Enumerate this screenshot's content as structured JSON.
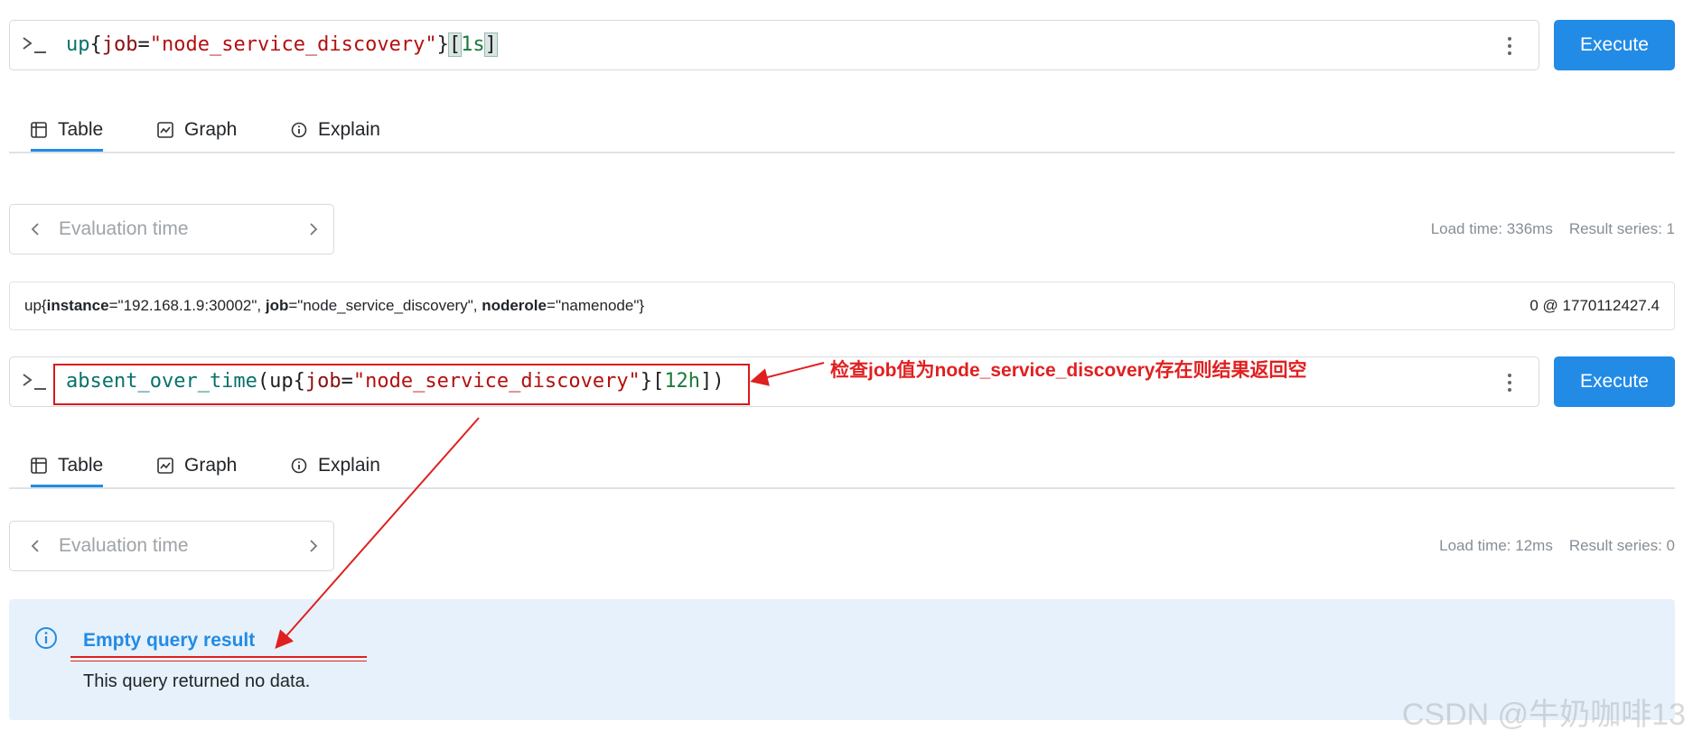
{
  "panels": [
    {
      "query": {
        "parts": [
          {
            "text": "up",
            "cls": "tk-fn"
          },
          {
            "text": "{",
            "cls": ""
          },
          {
            "text": "job",
            "cls": "tk-label"
          },
          {
            "text": "=",
            "cls": ""
          },
          {
            "text": "\"node_service_discovery\"",
            "cls": "tk-str"
          },
          {
            "text": "}",
            "cls": ""
          },
          {
            "text": "[",
            "cls": "tk-bracket"
          },
          {
            "text": "1s",
            "cls": "tk-num"
          },
          {
            "text": "]",
            "cls": "tk-bracket"
          }
        ]
      },
      "execute_label": "Execute",
      "tabs": [
        {
          "label": "Table",
          "icon": "table-icon",
          "active": true
        },
        {
          "label": "Graph",
          "icon": "graph-icon",
          "active": false
        },
        {
          "label": "Explain",
          "icon": "info-icon",
          "active": false
        }
      ],
      "eval_placeholder": "Evaluation time",
      "load_time": "Load time: 336ms",
      "result_series": "Result series: 1",
      "result": {
        "metric": "up",
        "labels": [
          {
            "name": "instance",
            "value": "\"192.168.1.9:30002\""
          },
          {
            "name": "job",
            "value": "\"node_service_discovery\""
          },
          {
            "name": "noderole",
            "value": "\"namenode\""
          }
        ],
        "value": "0 @ 1770112427.4"
      }
    },
    {
      "query": {
        "parts": [
          {
            "text": "absent_over_time",
            "cls": "tk-fn"
          },
          {
            "text": "(",
            "cls": ""
          },
          {
            "text": "up",
            "cls": ""
          },
          {
            "text": "{",
            "cls": ""
          },
          {
            "text": "job",
            "cls": "tk-label"
          },
          {
            "text": "=",
            "cls": ""
          },
          {
            "text": "\"node_service_discovery\"",
            "cls": "tk-str"
          },
          {
            "text": "}",
            "cls": ""
          },
          {
            "text": "[",
            "cls": ""
          },
          {
            "text": "12h",
            "cls": "tk-num"
          },
          {
            "text": "]",
            "cls": ""
          },
          {
            "text": ")",
            "cls": ""
          }
        ]
      },
      "execute_label": "Execute",
      "tabs": [
        {
          "label": "Table",
          "icon": "table-icon",
          "active": true
        },
        {
          "label": "Graph",
          "icon": "graph-icon",
          "active": false
        },
        {
          "label": "Explain",
          "icon": "info-icon",
          "active": false
        }
      ],
      "eval_placeholder": "Evaluation time",
      "load_time": "Load time: 12ms",
      "result_series": "Result series: 0",
      "empty": {
        "title": "Empty query result",
        "message": "This query returned no data."
      }
    }
  ],
  "annotation": "检查job值为node_service_discovery存在则结果返回空",
  "watermark": "CSDN @牛奶咖啡13",
  "colors": {
    "accent": "#228be6",
    "annotation_red": "#e02020",
    "alert_bg": "#e7f1fb"
  }
}
